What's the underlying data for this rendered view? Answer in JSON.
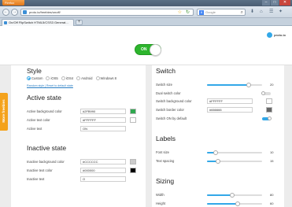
{
  "browser": {
    "app_button": "Firefox",
    "url": "proto.io/freebies/onoff/",
    "search_placeholder": "Google",
    "search_engine_letter": "8",
    "tab_title": "On/Off FlipSwitch HTML5/CSS3 Generat...",
    "new_tab": "+",
    "window_controls": [
      "–",
      "□",
      "✕"
    ],
    "back": "←",
    "forward": "→",
    "reload": "↻",
    "star": "☆",
    "search_go": "⌕"
  },
  "header": {
    "brand": "proto.io",
    "demo_switch_label": "ON"
  },
  "side_tab": "More freebies",
  "style": {
    "title": "Style",
    "options": [
      "Custom",
      "iOS5",
      "iOS4",
      "Android",
      "Windows 8"
    ],
    "selected": "Custom",
    "links": "Random style | Reset to default state"
  },
  "active_state": {
    "title": "Active state",
    "bg_label": "Active background color",
    "bg_value": "#2FB990",
    "bg_swatch": "#2fa84f",
    "text_color_label": "Active text color",
    "text_color_value": "#FFFFFF",
    "text_swatch": "#ffffff",
    "text_label": "Active text",
    "text_value": "ON"
  },
  "inactive_state": {
    "title": "Inactive state",
    "bg_label": "Inactive background color",
    "bg_value": "#CCCCCC",
    "bg_swatch": "#cccccc",
    "text_color_label": "Inactive text color",
    "text_color_value": "#000000",
    "text_swatch": "#000000",
    "text_label": "Inactive text",
    "text_value": "O"
  },
  "switch": {
    "title": "Switch",
    "size_label": "Switch size",
    "size_value": "20",
    "size_fraction": 0.75,
    "dual_label": "Dual switch color",
    "bg_color_label": "Switch background color",
    "bg_color_value": "#FFFFFF",
    "bg_swatch": "#ffffff",
    "border_color_label": "Switch border color",
    "border_color_value": "#666666",
    "border_swatch": "#666666",
    "default_on_label": "Switch ON by default"
  },
  "labels": {
    "title": "Labels",
    "font_size_label": "Font size",
    "font_size_value": "10",
    "font_size_fraction": 0.15,
    "spacing_label": "Text spacing",
    "spacing_value": "15",
    "spacing_fraction": 0.2
  },
  "sizing": {
    "title": "Sizing",
    "width_label": "Width",
    "width_value": "80",
    "width_fraction": 0.45,
    "height_label": "Height",
    "height_value": "60",
    "height_fraction": 0.55
  }
}
